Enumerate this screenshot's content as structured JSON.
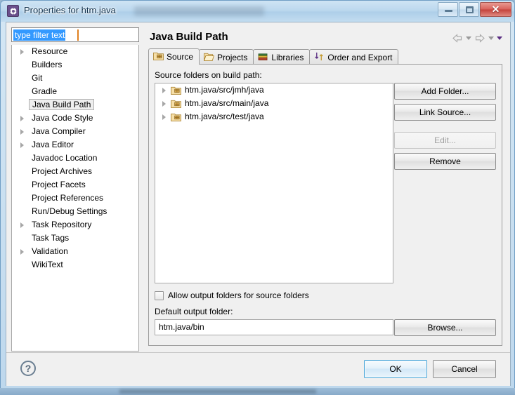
{
  "window": {
    "title": "Properties for htm.java",
    "app_icon": "gear-icon",
    "minimize_label": "Minimize",
    "maximize_label": "Maximize",
    "close_label": "Close"
  },
  "sidebar": {
    "filter": {
      "value": "type filter text",
      "placeholder": "type filter text",
      "selected": true
    },
    "items": [
      {
        "label": "Resource",
        "expandable": true,
        "selected": false
      },
      {
        "label": "Builders",
        "expandable": false,
        "selected": false
      },
      {
        "label": "Git",
        "expandable": false,
        "selected": false
      },
      {
        "label": "Gradle",
        "expandable": false,
        "selected": false
      },
      {
        "label": "Java Build Path",
        "expandable": false,
        "selected": true
      },
      {
        "label": "Java Code Style",
        "expandable": true,
        "selected": false
      },
      {
        "label": "Java Compiler",
        "expandable": true,
        "selected": false
      },
      {
        "label": "Java Editor",
        "expandable": true,
        "selected": false
      },
      {
        "label": "Javadoc Location",
        "expandable": false,
        "selected": false
      },
      {
        "label": "Project Archives",
        "expandable": false,
        "selected": false
      },
      {
        "label": "Project Facets",
        "expandable": false,
        "selected": false
      },
      {
        "label": "Project References",
        "expandable": false,
        "selected": false
      },
      {
        "label": "Run/Debug Settings",
        "expandable": false,
        "selected": false
      },
      {
        "label": "Task Repository",
        "expandable": true,
        "selected": false
      },
      {
        "label": "Task Tags",
        "expandable": false,
        "selected": false
      },
      {
        "label": "Validation",
        "expandable": true,
        "selected": false
      },
      {
        "label": "WikiText",
        "expandable": false,
        "selected": false
      }
    ]
  },
  "page": {
    "title": "Java Build Path",
    "nav": {
      "back_icon": "arrow-left-icon",
      "back_menu_icon": "chevron-down-icon",
      "forward_icon": "arrow-right-icon",
      "forward_menu_icon": "chevron-down-icon",
      "view_menu_icon": "triangle-down-icon"
    },
    "tabs": [
      {
        "label": "Source",
        "icon": "package-folder-icon",
        "active": true
      },
      {
        "label": "Projects",
        "icon": "open-folder-icon",
        "active": false
      },
      {
        "label": "Libraries",
        "icon": "books-icon",
        "active": false
      },
      {
        "label": "Order and Export",
        "icon": "reorder-arrows-icon",
        "active": false
      }
    ],
    "source_tab": {
      "list_label": "Source folders on build path:",
      "folders": [
        {
          "path": "htm.java/src/jmh/java",
          "icon": "package-folder-icon",
          "expandable": true
        },
        {
          "path": "htm.java/src/main/java",
          "icon": "package-folder-icon",
          "expandable": true
        },
        {
          "path": "htm.java/src/test/java",
          "icon": "package-folder-icon",
          "expandable": true
        }
      ],
      "buttons": [
        {
          "label": "Add Folder...",
          "enabled": true
        },
        {
          "label": "Link Source...",
          "enabled": true
        },
        {
          "label": "Edit...",
          "enabled": false
        },
        {
          "label": "Remove",
          "enabled": true
        }
      ],
      "allow_output_folders": {
        "label": "Allow output folders for source folders",
        "checked": false
      },
      "default_output": {
        "label": "Default output folder:",
        "value": "htm.java/bin",
        "browse_label": "Browse..."
      }
    }
  },
  "footer": {
    "help_icon": "question-mark-icon",
    "ok_label": "OK",
    "cancel_label": "Cancel"
  },
  "colors": {
    "selection_blue": "#3399ff",
    "caret_orange": "#e08020",
    "default_button_border": "#3c9fd6",
    "close_button_red": "#c4423c",
    "title_icon_purple": "#6a4f8c"
  }
}
